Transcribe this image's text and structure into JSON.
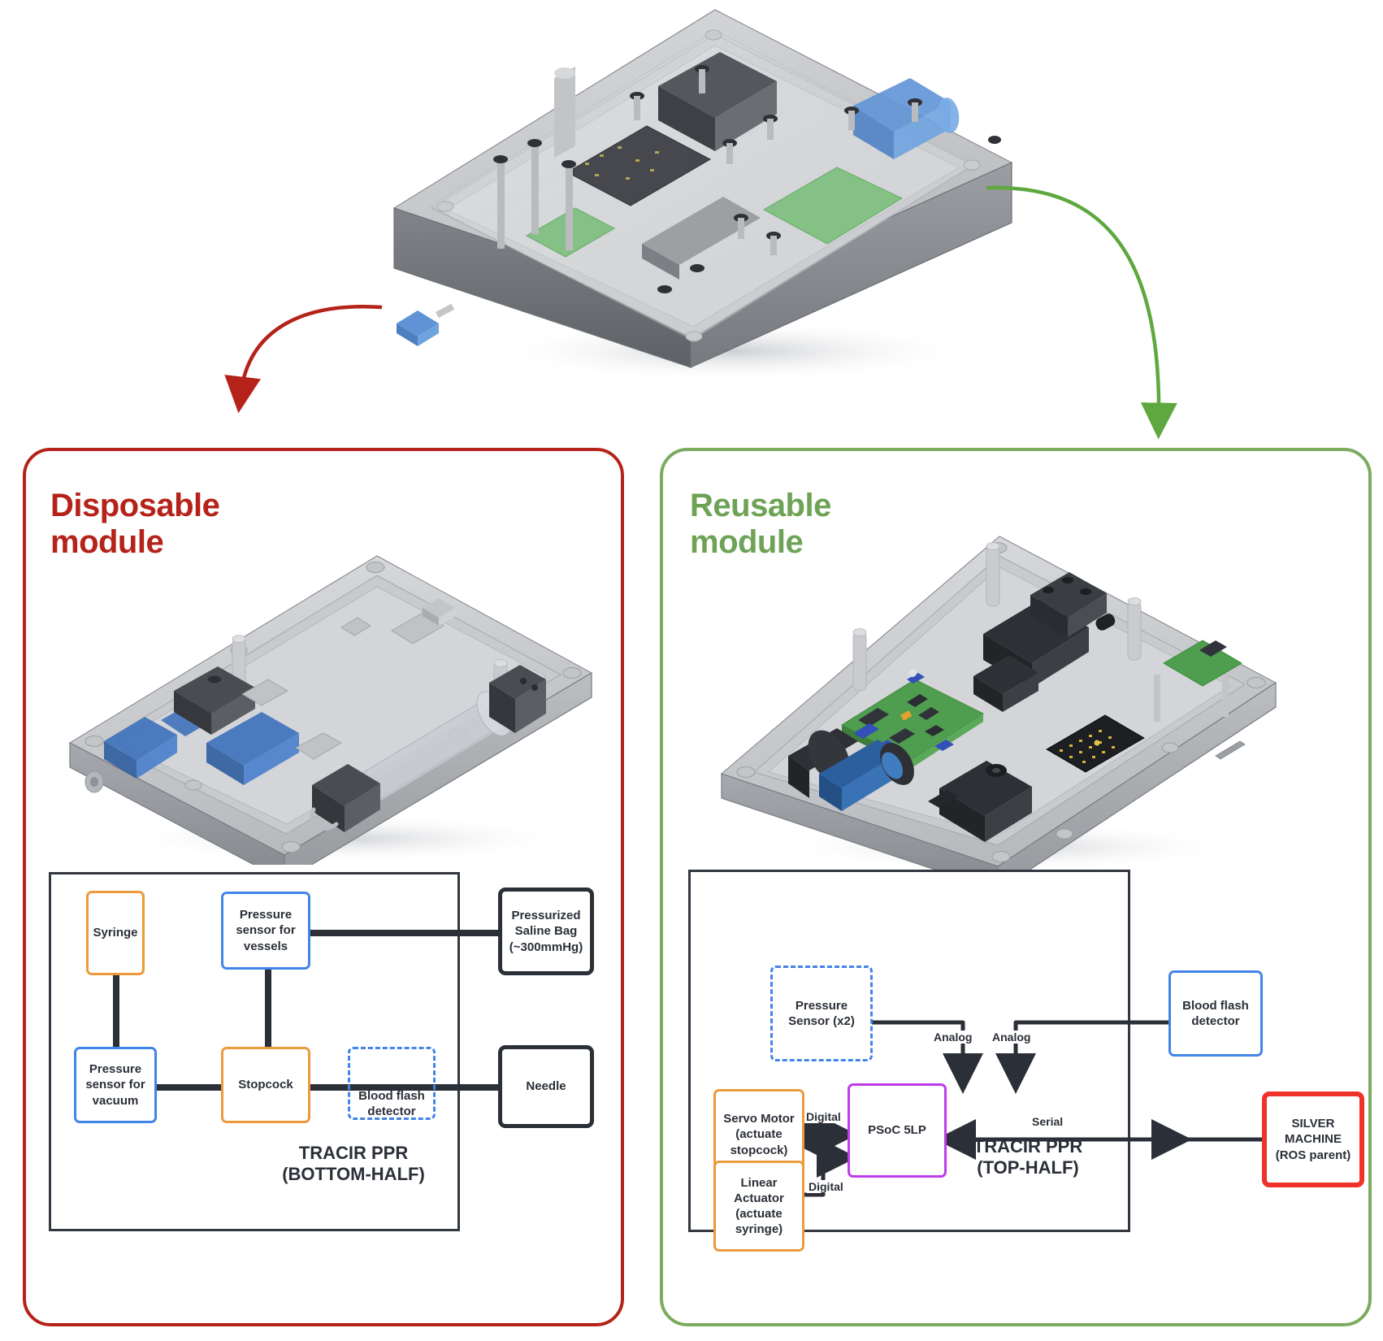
{
  "figure": {
    "top_render_label": "full-assembly-cad-render"
  },
  "modules": {
    "disposable": {
      "title": "Disposable\nmodule",
      "accent": "#b52219",
      "render_label": "disposable-module-cad-render",
      "caption": "TRACIR PPR\n(BOTTOM-HALF)"
    },
    "reusable": {
      "title": "Reusable\nmodule",
      "accent": "#7aab5e",
      "render_label": "reusable-module-cad-render",
      "caption": "TRACIR PPR\n(TOP-HALF)"
    }
  },
  "bottom_half_diagram": {
    "nodes": {
      "syringe": "Syringe",
      "pressure_sensor_vessels": "Pressure\nsensor for\nvessels",
      "pressure_sensor_vacuum": "Pressure\nsensor for\nvacuum",
      "stopcock": "Stopcock",
      "blood_flash_detector": "Blood flash\ndetector",
      "saline_bag": "Pressurized\nSaline Bag\n(~300mmHg)",
      "needle": "Needle"
    },
    "node_colors": {
      "syringe": "#eb9a3c",
      "pressure_sensor_vessels": "#4285e8",
      "pressure_sensor_vacuum": "#4285e8",
      "stopcock": "#eb9a3c",
      "blood_flash_detector": "#4285e8",
      "saline_bag": "#2b2f38",
      "needle": "#2b2f38"
    }
  },
  "top_half_diagram": {
    "nodes": {
      "pressure_sensor": "Pressure\nSensor (x2)",
      "blood_flash_detector": "Blood flash\ndetector",
      "servo_motor": "Servo Motor\n(actuate\nstopcock)",
      "linear_actuator": "Linear\nActuator\n(actuate\nsyringe)",
      "psoc": "PSoC 5LP",
      "silver_machine": "SILVER\nMACHINE\n(ROS parent)"
    },
    "node_colors": {
      "pressure_sensor": "#4285e8",
      "blood_flash_detector": "#4285e8",
      "servo_motor": "#eb9a3c",
      "linear_actuator": "#eb9a3c",
      "psoc": "#c13bec",
      "silver_machine": "#f0332a"
    },
    "signal_labels": {
      "analog_left": "Analog",
      "analog_right": "Analog",
      "digital_servo": "Digital",
      "digital_actuator": "Digital",
      "serial": "Serial"
    }
  }
}
